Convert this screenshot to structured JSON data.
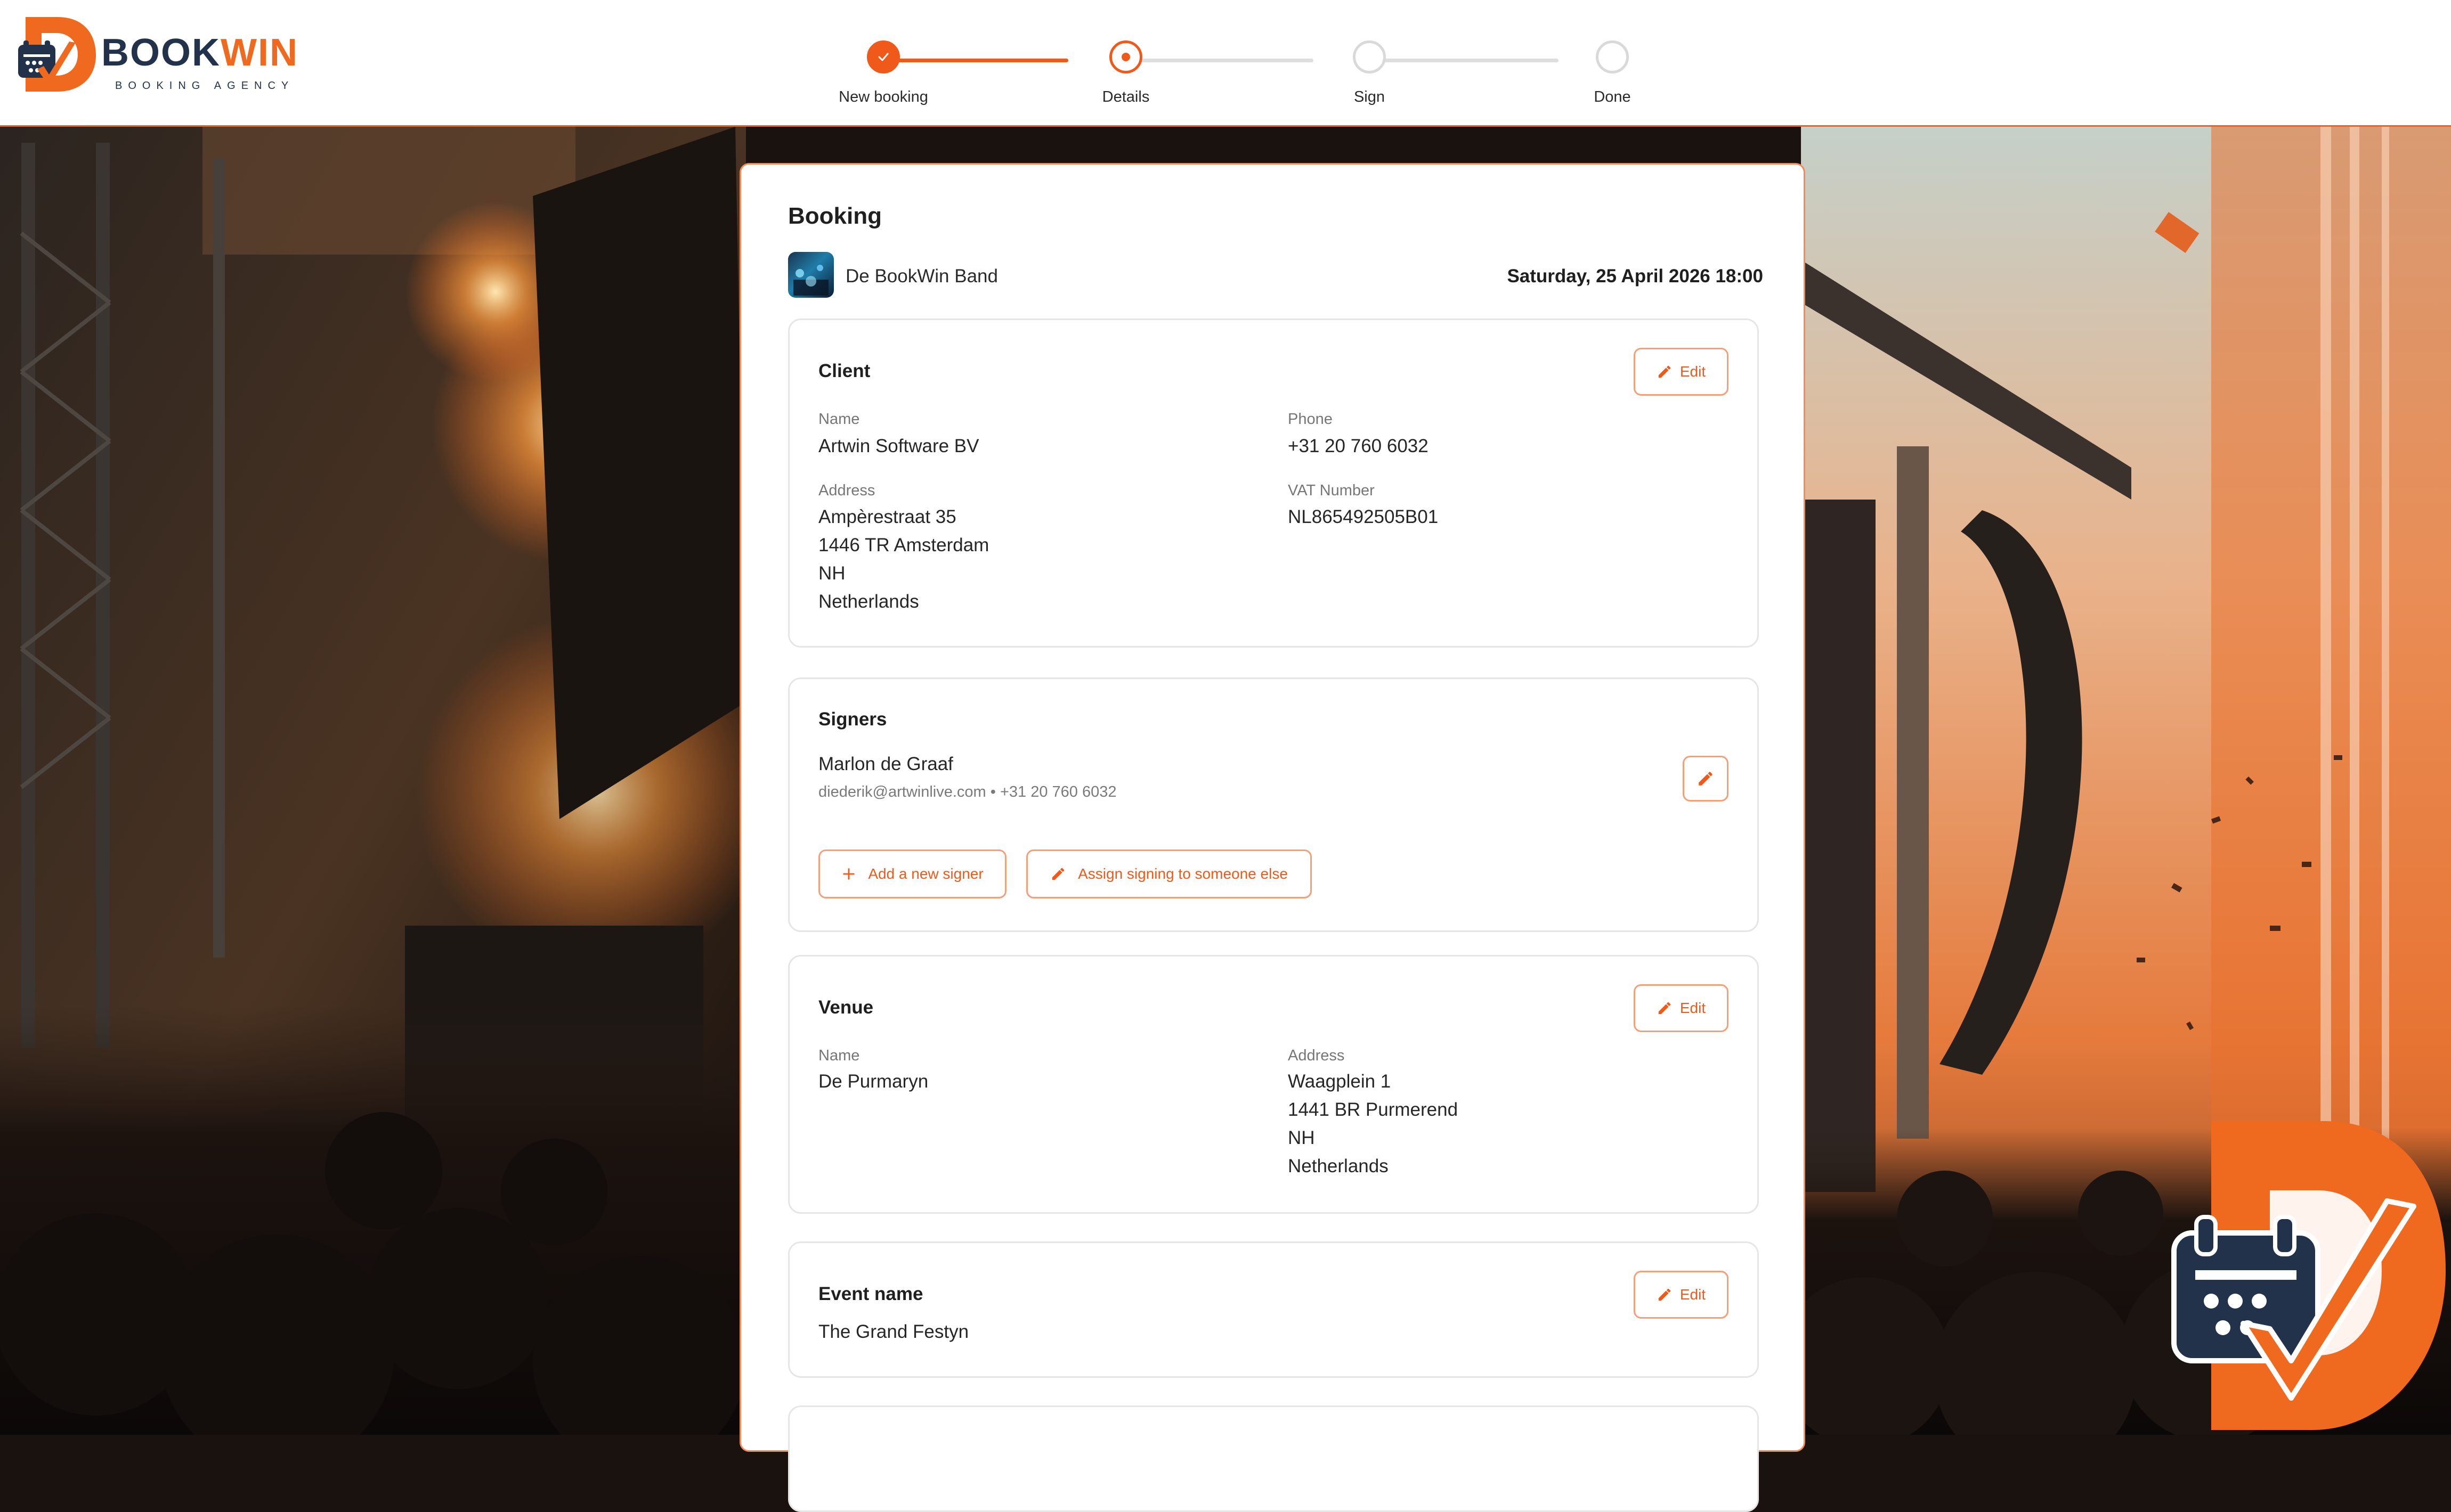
{
  "app": {
    "brand_name_part1": "BOOK",
    "brand_name_part2": "WIN",
    "brand_tagline": "BOOKING AGENCY",
    "accent_color": "#ef5a1a",
    "navy_color": "#22324a"
  },
  "stepper": {
    "steps": [
      {
        "label": "New booking",
        "state": "complete",
        "icon": "check-icon"
      },
      {
        "label": "Details",
        "state": "current"
      },
      {
        "label": "Sign",
        "state": "upcoming"
      },
      {
        "label": "Done",
        "state": "upcoming"
      }
    ]
  },
  "booking": {
    "title": "Booking",
    "artist_name": "De BookWin Band",
    "event_datetime": "Saturday, 25 April 2026 18:00"
  },
  "client": {
    "title": "Client",
    "edit_label": "Edit",
    "name_label": "Name",
    "name": "Artwin Software BV",
    "phone_label": "Phone",
    "phone": "+31 20 760 6032",
    "address_label": "Address",
    "address_lines": [
      "Ampèrestraat 35",
      "1446 TR Amsterdam",
      "NH",
      "Netherlands"
    ],
    "vat_label": "VAT Number",
    "vat": "NL865492505B01"
  },
  "signers": {
    "title": "Signers",
    "signer_name": "Marlon de Graaf",
    "signer_contact": "diederik@artwinlive.com • +31 20 760 6032",
    "add_signer_label": "Add a new signer",
    "assign_label": "Assign signing to someone else"
  },
  "venue": {
    "title": "Venue",
    "edit_label": "Edit",
    "name_label": "Name",
    "name": "De Purmaryn",
    "address_label": "Address",
    "address_lines": [
      "Waagplein 1",
      "1441 BR Purmerend",
      "NH",
      "Netherlands"
    ]
  },
  "event": {
    "title": "Event name",
    "edit_label": "Edit",
    "name": "The Grand Festyn"
  }
}
